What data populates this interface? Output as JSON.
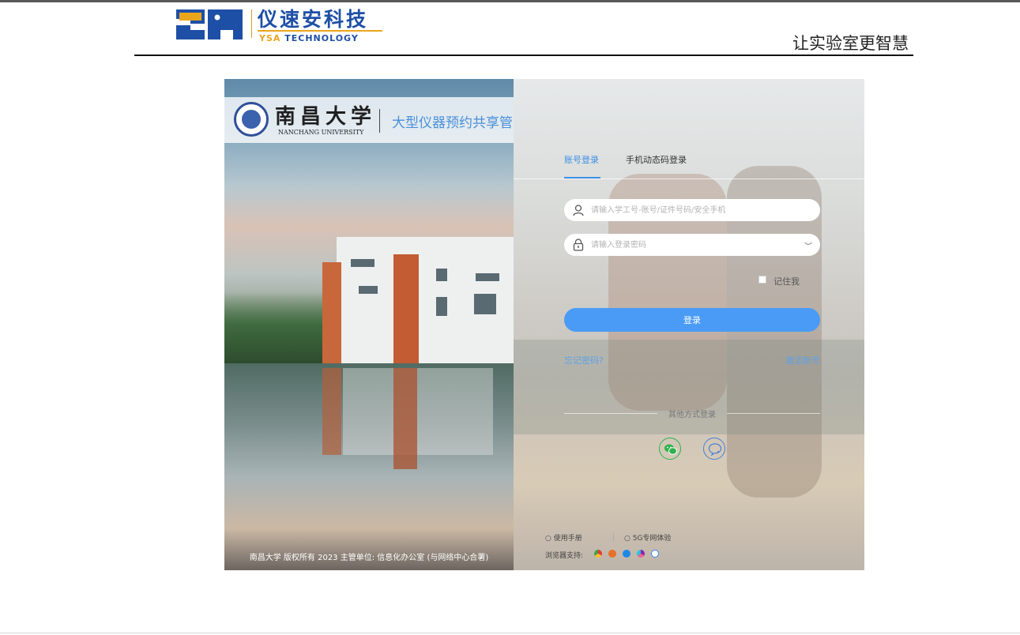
{
  "header": {
    "logo_mark": "YSA",
    "logo_cn": "仪速安科技",
    "logo_en_highlight": "YSA",
    "logo_en_rest": " TECHNOLOGY",
    "slogan": "让实验室更智慧"
  },
  "left_panel": {
    "university_cn": "南昌大学",
    "university_en": "NANCHANG UNIVERSITY",
    "system_name": "大型仪器预约共享管",
    "copyright": "南昌大学 版权所有 2023 主管单位: 信息化办公室 (与网络中心合署)"
  },
  "login": {
    "tabs": [
      {
        "label": "账号登录",
        "active": true
      },
      {
        "label": "手机动态码登录",
        "active": false
      }
    ],
    "username_placeholder": "请输入学工号-账号/证件号码/安全手机",
    "password_placeholder": "请输入登录密码",
    "remember_label": "记住我",
    "remember_checked": false,
    "submit_label": "登录",
    "forgot_label": "忘记密码?",
    "activate_label": "激活账号",
    "other_methods_label": "其他方式登录",
    "social": [
      "wechat-icon",
      "chat-icon"
    ]
  },
  "footer": {
    "manual_label": "使用手册",
    "network_label": "5G专网体验",
    "browser_label": "浏览器支持:",
    "browsers": [
      "chrome-icon",
      "firefox-icon",
      "ie-icon",
      "safari-icon",
      "other-browser-icon"
    ]
  },
  "colors": {
    "accent": "#4a9bf5",
    "tab_active": "#3d8fe6",
    "link": "#5fa2e6",
    "brand_blue": "#1e4fa6",
    "brand_orange": "#e9a51c"
  }
}
